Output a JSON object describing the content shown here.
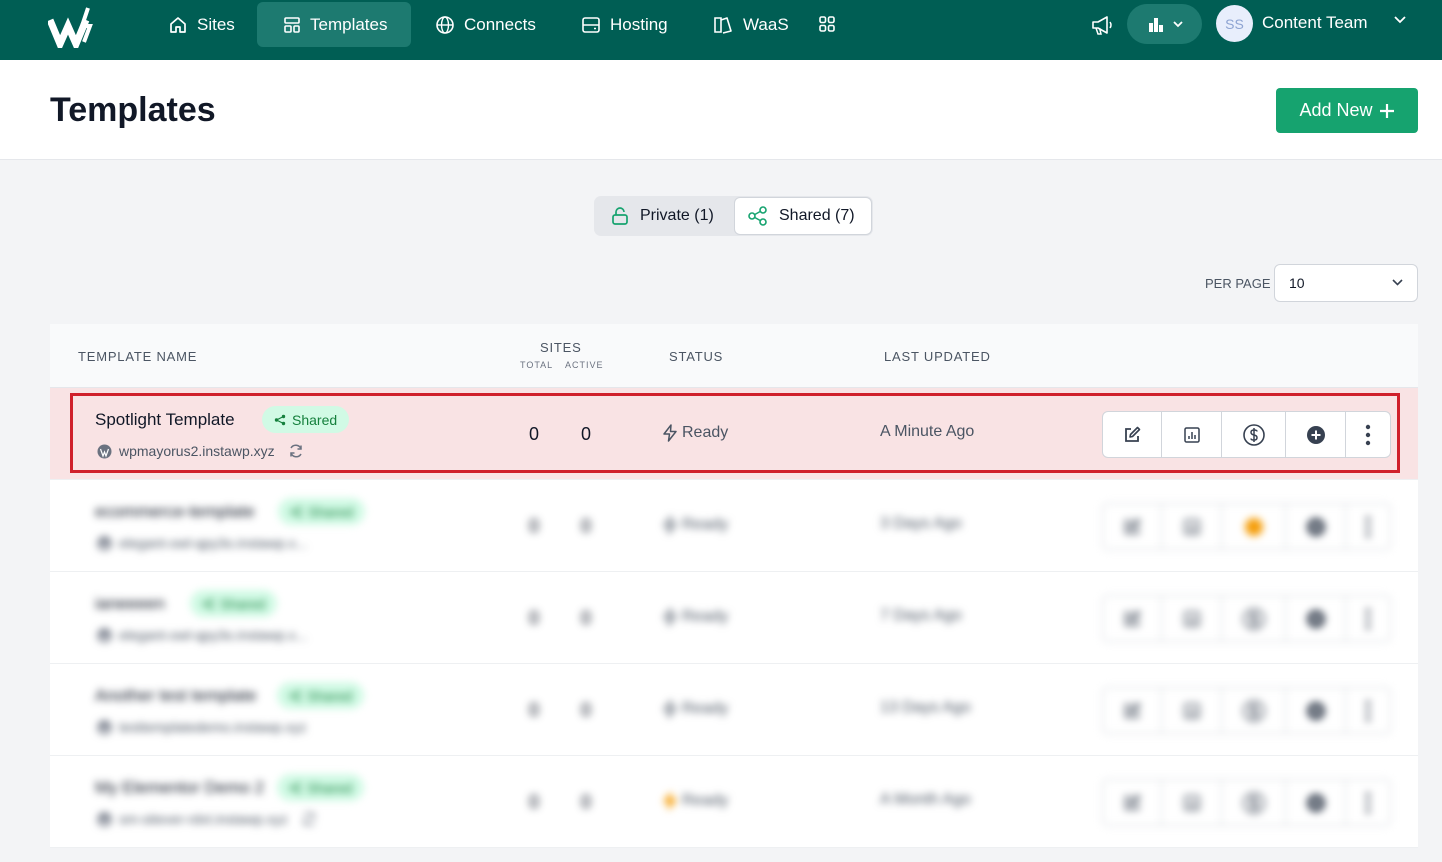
{
  "nav": {
    "items": [
      {
        "label": "Sites",
        "icon": "home-icon"
      },
      {
        "label": "Templates",
        "icon": "template-icon",
        "active": true
      },
      {
        "label": "Connects",
        "icon": "globe-icon"
      },
      {
        "label": "Hosting",
        "icon": "server-icon"
      },
      {
        "label": "WaaS",
        "icon": "waas-icon"
      }
    ],
    "team_avatar": "SS",
    "team_name": "Content Team"
  },
  "header": {
    "title": "Templates",
    "add_new_label": "Add New"
  },
  "tabs": {
    "private_label": "Private (1)",
    "shared_label": "Shared (7)",
    "selected": "shared"
  },
  "pagination": {
    "per_page_label": "PER PAGE",
    "per_page_value": "10"
  },
  "table": {
    "headers": {
      "name": "TEMPLATE NAME",
      "sites": "SITES",
      "sites_total": "TOTAL",
      "sites_active": "ACTIVE",
      "status": "STATUS",
      "updated": "LAST UPDATED"
    },
    "rows": [
      {
        "name": "Spotlight Template",
        "badge": "Shared",
        "url": "wpmayorus2.instawp.xyz",
        "total": "0",
        "active": "0",
        "status": "Ready",
        "updated": "A Minute Ago"
      },
      {
        "name": "ecommerce-template",
        "badge": "Shared",
        "url": "elegant-owl-qpy3o.instawp.x...",
        "total": "0",
        "active": "0",
        "status": "Ready",
        "updated": "3 Days Ago"
      },
      {
        "name": "ianeeeen",
        "badge": "Shared",
        "url": "elegant-owl-qpy3o.instawp.x...",
        "total": "0",
        "active": "0",
        "status": "Ready",
        "updated": "7 Days Ago"
      },
      {
        "name": "Another test template",
        "badge": "Shared",
        "url": "testtemplatedemo.instawp.xyz",
        "total": "0",
        "active": "0",
        "status": "Ready",
        "updated": "13 Days Ago"
      },
      {
        "name": "My Elementor Demo 2",
        "badge": "Shared",
        "url": "sm-sitever-rdvt.instawp.xyz",
        "total": "0",
        "active": "0",
        "status": "Ready",
        "updated": "A Month Ago"
      }
    ]
  },
  "colors": {
    "nav_bg": "#005e54",
    "brand_green": "#16a36f",
    "highlight_border": "#d0202b"
  }
}
